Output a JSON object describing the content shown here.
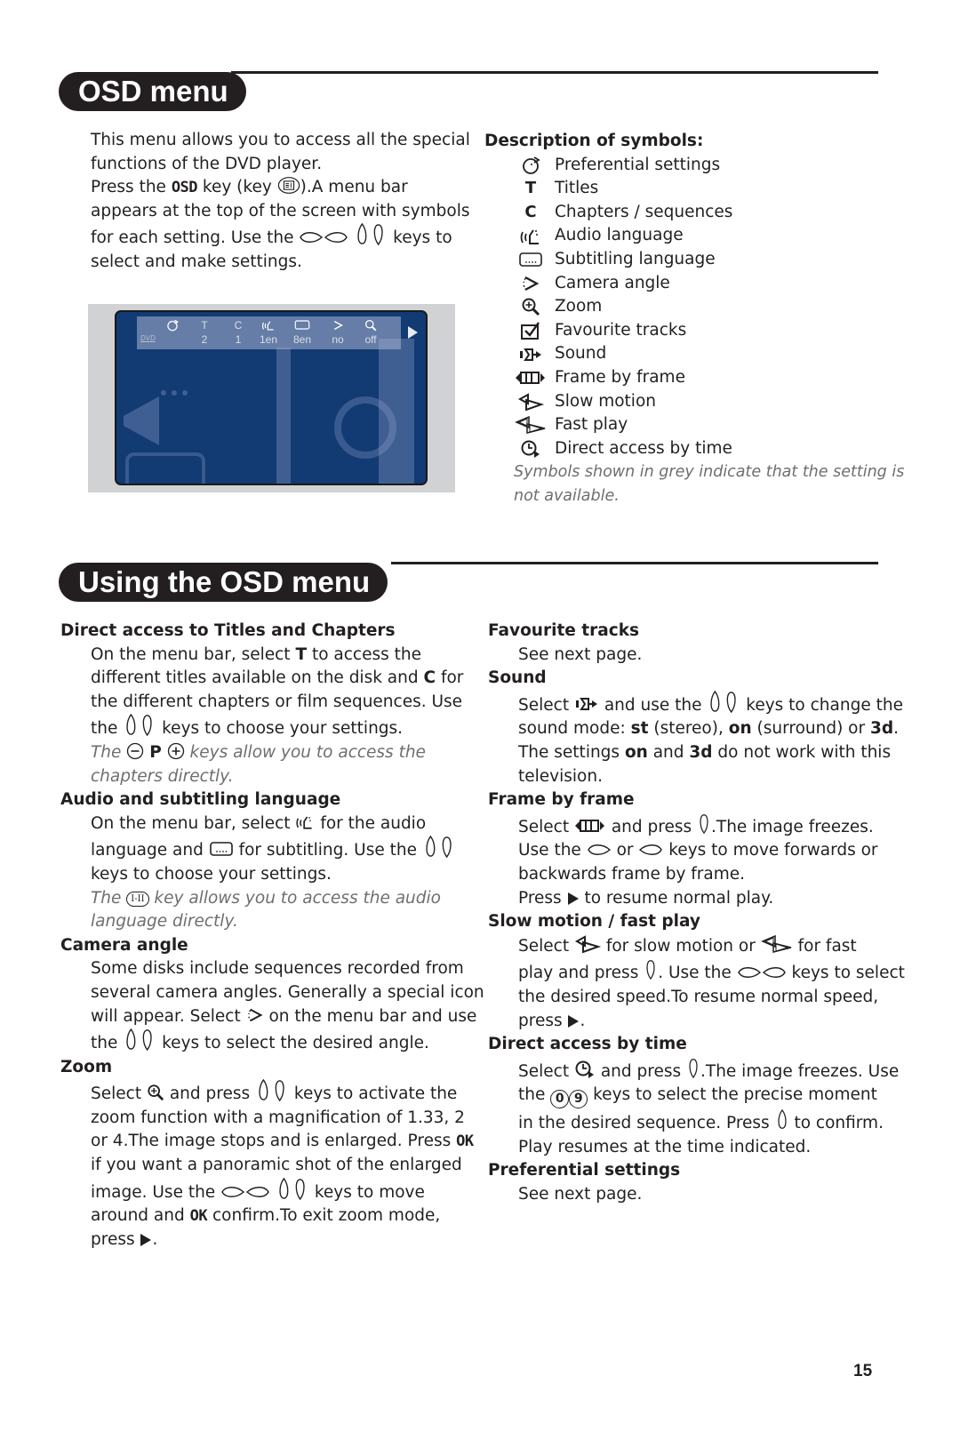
{
  "section1": {
    "title": "OSD menu",
    "intro": {
      "line1": "This menu allows you to access all the special",
      "line2": "functions of the DVD player.",
      "line3_pre": "Press the ",
      "line3_key": "OSD",
      "line3_mid": " key (key ",
      "line3_post": ").A menu bar",
      "line4": "appears at the top of the screen with symbols",
      "line5_pre": "for each setting. Use the ",
      "line5_post": " keys to",
      "line6": "select and make settings."
    },
    "tv": {
      "symbols": [
        "preferential-settings",
        "T",
        "C",
        "audio-language",
        "subtitle",
        "camera-angle",
        "zoom"
      ],
      "values": [
        "",
        "2",
        "1",
        "1en",
        "8en",
        "no",
        "off"
      ],
      "disc_label": "DVD"
    },
    "symbols_heading": "Description of symbols:",
    "symbols": [
      {
        "icon": "preferential-settings-icon",
        "glyph": "",
        "label": "Preferential settings"
      },
      {
        "icon": "titles-icon",
        "glyph": "T",
        "label": "Titles"
      },
      {
        "icon": "chapters-icon",
        "glyph": "C",
        "label": "Chapters / sequences"
      },
      {
        "icon": "audio-language-icon",
        "glyph": "",
        "label": "Audio language"
      },
      {
        "icon": "subtitle-icon",
        "glyph": "",
        "label": "Subtitling language"
      },
      {
        "icon": "camera-angle-icon",
        "glyph": "",
        "label": "Camera angle"
      },
      {
        "icon": "zoom-icon",
        "glyph": "",
        "label": "Zoom"
      },
      {
        "icon": "favourite-tracks-icon",
        "glyph": "",
        "label": "Favourite tracks"
      },
      {
        "icon": "sound-icon",
        "glyph": "",
        "label": "Sound"
      },
      {
        "icon": "frame-by-frame-icon",
        "glyph": "",
        "label": "Frame by frame"
      },
      {
        "icon": "slow-motion-icon",
        "glyph": "",
        "label": "Slow motion"
      },
      {
        "icon": "fast-play-icon",
        "glyph": "",
        "label": "Fast play"
      },
      {
        "icon": "direct-access-time-icon",
        "glyph": "",
        "label": "Direct access by time"
      }
    ],
    "grey_note_1": "Symbols shown in grey indicate that the setting is",
    "grey_note_2": "not available."
  },
  "section2": {
    "title": "Using the OSD menu",
    "left": {
      "titles_chapters": {
        "heading": "Direct access to Titles and Chapters",
        "l1_pre": "On the menu bar, select ",
        "l1_b": "T",
        "l1_post": " to access the",
        "l2_pre": "different titles available on the disk and ",
        "l2_b": "C",
        "l2_post": " for",
        "l3": "the different chapters or film sequences. Use",
        "l4_pre": "the ",
        "l4_post": " keys to choose your settings.",
        "n1_pre": "The ",
        "n1_p": "P",
        "n1_post": " keys allow you to access the",
        "n2": "chapters directly."
      },
      "audio_subtitle": {
        "heading": "Audio and subtitling language",
        "l1_pre": "On the menu bar, select ",
        "l1_post": " for the audio",
        "l2_pre": "language and ",
        "l2_post": " for subtitling. Use the ",
        "l3": "keys to choose your settings.",
        "n1_pre": "The ",
        "n1_key": "I-II",
        "n1_post": " key allows you to access the audio",
        "n2": "language directly."
      },
      "camera_angle": {
        "heading": "Camera angle",
        "l1": "Some disks include sequences recorded from",
        "l2": "several camera angles. Generally a special icon",
        "l3_pre": "will appear. Select ",
        "l3_post": " on the menu bar and use",
        "l4_pre": "the ",
        "l4_post": " keys to select the desired angle."
      },
      "zoom": {
        "heading": "Zoom",
        "l1_pre": "Select ",
        "l1_mid": " and press ",
        "l1_post": " keys to activate the",
        "l2": "zoom function with a magnification of 1.33, 2",
        "l3_pre": "or 4.The image stops and is enlarged. Press ",
        "l3_key": "OK",
        "l4": "if you want a panoramic shot of the enlarged",
        "l5_pre": "image. Use the ",
        "l5_post": " keys to move",
        "l6_pre": "around and ",
        "l6_key": "OK",
        "l6_post": " confirm.To exit zoom mode,",
        "l7_pre": "press ",
        "l7_post": "."
      }
    },
    "right": {
      "favourite": {
        "heading": "Favourite tracks",
        "l1": "See next page."
      },
      "sound": {
        "heading": "Sound",
        "l1_pre": "Select ",
        "l1_mid": " and use the ",
        "l1_post": " keys to change the",
        "l2_pre": "sound mode: ",
        "l2_b1": "st",
        "l2_m1": " (stereo), ",
        "l2_b2": "on",
        "l2_m2": " (surround) or ",
        "l2_b3": "3d",
        "l2_post": ".",
        "l3_pre": "The settings ",
        "l3_b1": "on",
        "l3_mid": " and ",
        "l3_b2": "3d",
        "l3_post": " do not work with this",
        "l4": "television."
      },
      "frame": {
        "heading": "Frame by frame",
        "l1_pre": "Select ",
        "l1_mid": " and press ",
        "l1_post": ".The image freezes.",
        "l2_pre": "Use the ",
        "l2_mid": " or ",
        "l2_post": " keys to move forwards or",
        "l3": "backwards frame by frame.",
        "l4_pre": "Press ",
        "l4_post": " to resume normal play."
      },
      "slow_fast": {
        "heading": "Slow motion / fast play",
        "l1_pre": "Select ",
        "l1_mid": " for slow motion or ",
        "l1_post": " for fast",
        "l2_pre": "play and press ",
        "l2_mid": ". Use the ",
        "l2_post": " keys to select",
        "l3": "the desired speed.To resume normal speed,",
        "l4_pre": "press ",
        "l4_post": "."
      },
      "direct_time": {
        "heading": "Direct access by time",
        "l1_pre": "Select ",
        "l1_mid": " and press ",
        "l1_post": ".The image freezes. Use",
        "l2_pre": "the ",
        "l2_k1": "0",
        "l2_k2": "9",
        "l2_post": " keys to select the precise moment",
        "l3_pre": "in the desired sequence. Press ",
        "l3_post": " to confirm.",
        "l4": "Play resumes at the time indicated."
      },
      "preferential": {
        "heading": "Preferential settings",
        "l1": "See next page."
      }
    }
  },
  "page_number": "15"
}
